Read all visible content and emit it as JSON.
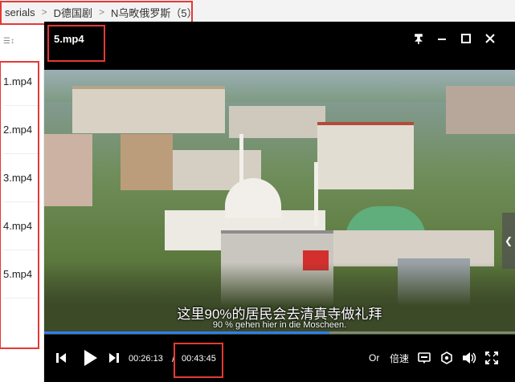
{
  "breadcrumb": {
    "items": [
      "serials",
      "D德国剧",
      "N乌畋俄罗斯（5）"
    ]
  },
  "sidebar": {
    "sort_icon": "sort-icon",
    "files": [
      "1.mp4",
      "2.mp4",
      "3.mp4",
      "4.mp4",
      "5.mp4"
    ]
  },
  "player": {
    "title": "5.mp4",
    "window_buttons": [
      "pin-icon",
      "minimize-icon",
      "maximize-icon",
      "close-icon"
    ],
    "subtitle_cn": "这里90%的居民会去清真寺做礼拜",
    "subtitle_de": "90 % gehen hier in die Moscheen.",
    "progress": 0.606,
    "time_current": "00:26:13",
    "time_sep": "/",
    "time_total": "00:43:45",
    "label_or": "Or",
    "label_speed": "倍速",
    "colors": {
      "progress": "#2f7df6",
      "highlight": "#e53935"
    }
  }
}
